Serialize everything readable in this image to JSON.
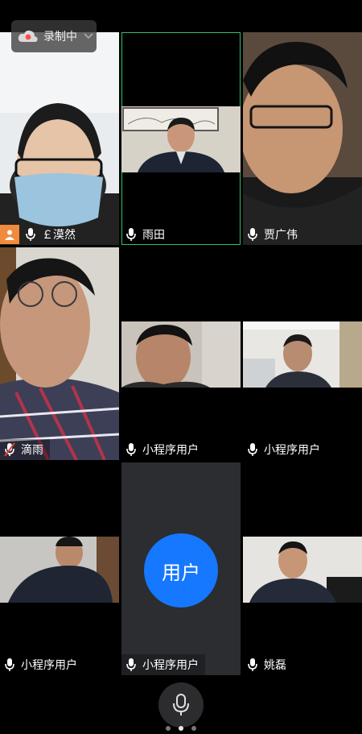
{
  "recording": {
    "label": "录制中",
    "indicator_color": "#ff4d4f"
  },
  "participants": [
    {
      "name": "￡漠然",
      "role_badge": "host-icon",
      "muted": false,
      "speaking": false
    },
    {
      "name": "雨田",
      "muted": false,
      "speaking": true
    },
    {
      "name": "贾广伟",
      "muted": false,
      "speaking": false
    },
    {
      "name": "滴雨",
      "muted": true,
      "speaking": false
    },
    {
      "name": "小程序用户",
      "muted": false,
      "speaking": false
    },
    {
      "name": "小程序用户",
      "muted": false,
      "speaking": false
    },
    {
      "name": "小程序用户",
      "muted": false,
      "speaking": false
    },
    {
      "name": "小程序用户",
      "avatar_text": "用户",
      "camera_off": true
    },
    {
      "name": "姚磊",
      "muted": false,
      "speaking": false
    }
  ],
  "pager": {
    "pages": 3,
    "current": 2
  },
  "colors": {
    "accent": "#1677ff",
    "speaking_border": "#2fc26a",
    "muted_icon": "#e0423b"
  }
}
